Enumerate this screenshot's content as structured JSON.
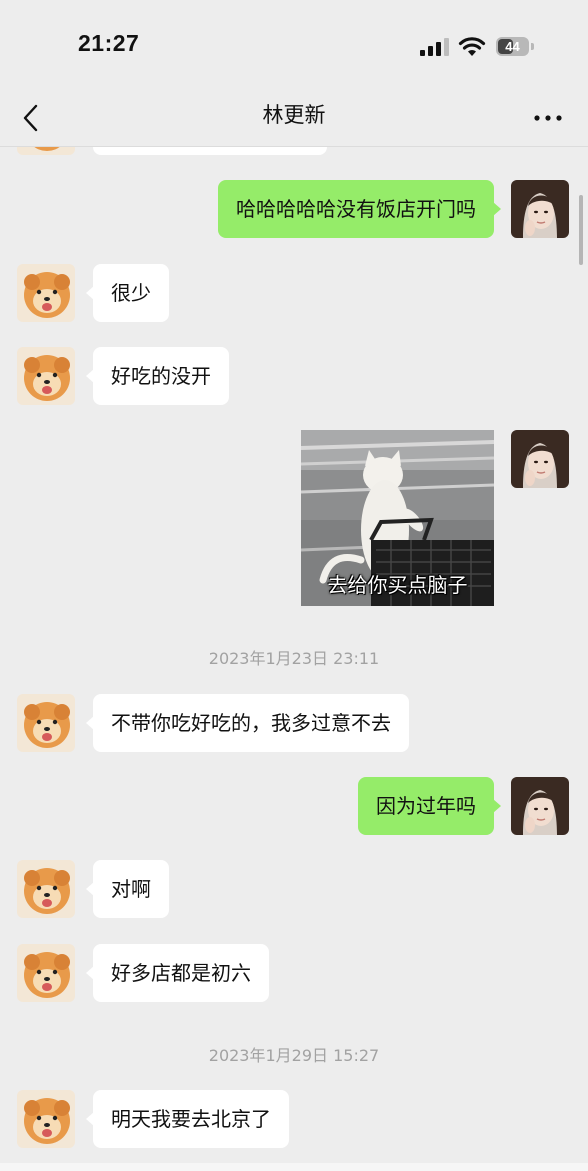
{
  "status_bar": {
    "time": "21:27",
    "battery": "44",
    "icons": [
      "signal-icon",
      "wifi-icon",
      "battery-icon"
    ]
  },
  "nav": {
    "title": "林更新",
    "back_icon": "chevron-left-icon",
    "more_icon": "more-icon"
  },
  "colors": {
    "background": "#ededed",
    "sent_bubble": "#95ec69",
    "received_bubble": "#ffffff",
    "timestamp": "#a2a2a2"
  },
  "messages": [
    {
      "side": "right",
      "type": "text",
      "text": "哈哈哈哈哈没有饭店开门吗"
    },
    {
      "side": "left",
      "type": "text",
      "text": "很少"
    },
    {
      "side": "left",
      "type": "text",
      "text": "好吃的没开"
    },
    {
      "side": "right",
      "type": "sticker",
      "caption": "去给你买点脑子"
    },
    {
      "type": "timestamp",
      "text": "2023年1月23日 23:11"
    },
    {
      "side": "left",
      "type": "text",
      "text": "不带你吃好吃的，我多过意不去"
    },
    {
      "side": "right",
      "type": "text",
      "text": "因为过年吗"
    },
    {
      "side": "left",
      "type": "text",
      "text": "对啊"
    },
    {
      "side": "left",
      "type": "text",
      "text": "好多店都是初六"
    },
    {
      "type": "timestamp",
      "text": "2023年1月29日 15:27"
    },
    {
      "side": "left",
      "type": "text",
      "text": "明天我要去北京了"
    }
  ]
}
